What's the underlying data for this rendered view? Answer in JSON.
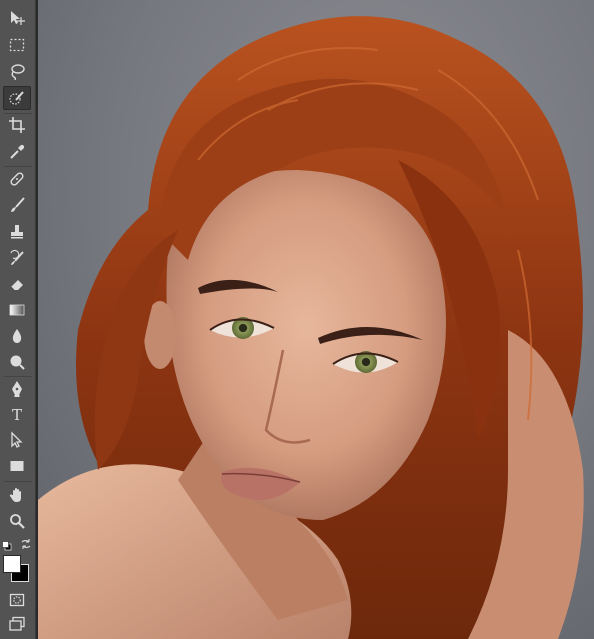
{
  "app": {
    "name": "photo-editor"
  },
  "toolbar": {
    "tools": [
      {
        "id": "move",
        "icon": "move-icon"
      },
      {
        "id": "marquee",
        "icon": "rectangular-marquee-icon"
      },
      {
        "id": "lasso",
        "icon": "lasso-icon"
      },
      {
        "id": "quick-select",
        "icon": "quick-selection-icon",
        "active": true
      },
      {
        "id": "crop",
        "icon": "crop-icon"
      },
      {
        "id": "eyedropper",
        "icon": "eyedropper-icon"
      },
      {
        "id": "healing",
        "icon": "healing-brush-icon"
      },
      {
        "id": "brush",
        "icon": "brush-icon"
      },
      {
        "id": "clone",
        "icon": "clone-stamp-icon"
      },
      {
        "id": "history-brush",
        "icon": "history-brush-icon"
      },
      {
        "id": "eraser",
        "icon": "eraser-icon"
      },
      {
        "id": "gradient",
        "icon": "gradient-icon"
      },
      {
        "id": "blur",
        "icon": "blur-drop-icon"
      },
      {
        "id": "dodge",
        "icon": "dodge-icon"
      },
      {
        "id": "pen",
        "icon": "pen-icon"
      },
      {
        "id": "type",
        "icon": "type-icon",
        "label": "T"
      },
      {
        "id": "path-select",
        "icon": "path-selection-icon"
      },
      {
        "id": "rectangle",
        "icon": "rectangle-shape-icon"
      },
      {
        "id": "hand",
        "icon": "hand-icon"
      },
      {
        "id": "zoom",
        "icon": "zoom-icon"
      }
    ],
    "colors": {
      "foreground": "#ffffff",
      "background": "#000000"
    }
  },
  "canvas": {
    "background": "#7b7d84",
    "hair_color": "#9a3a12",
    "skin_color": "#d9a48a",
    "eye_color": "#7e8a4a"
  }
}
